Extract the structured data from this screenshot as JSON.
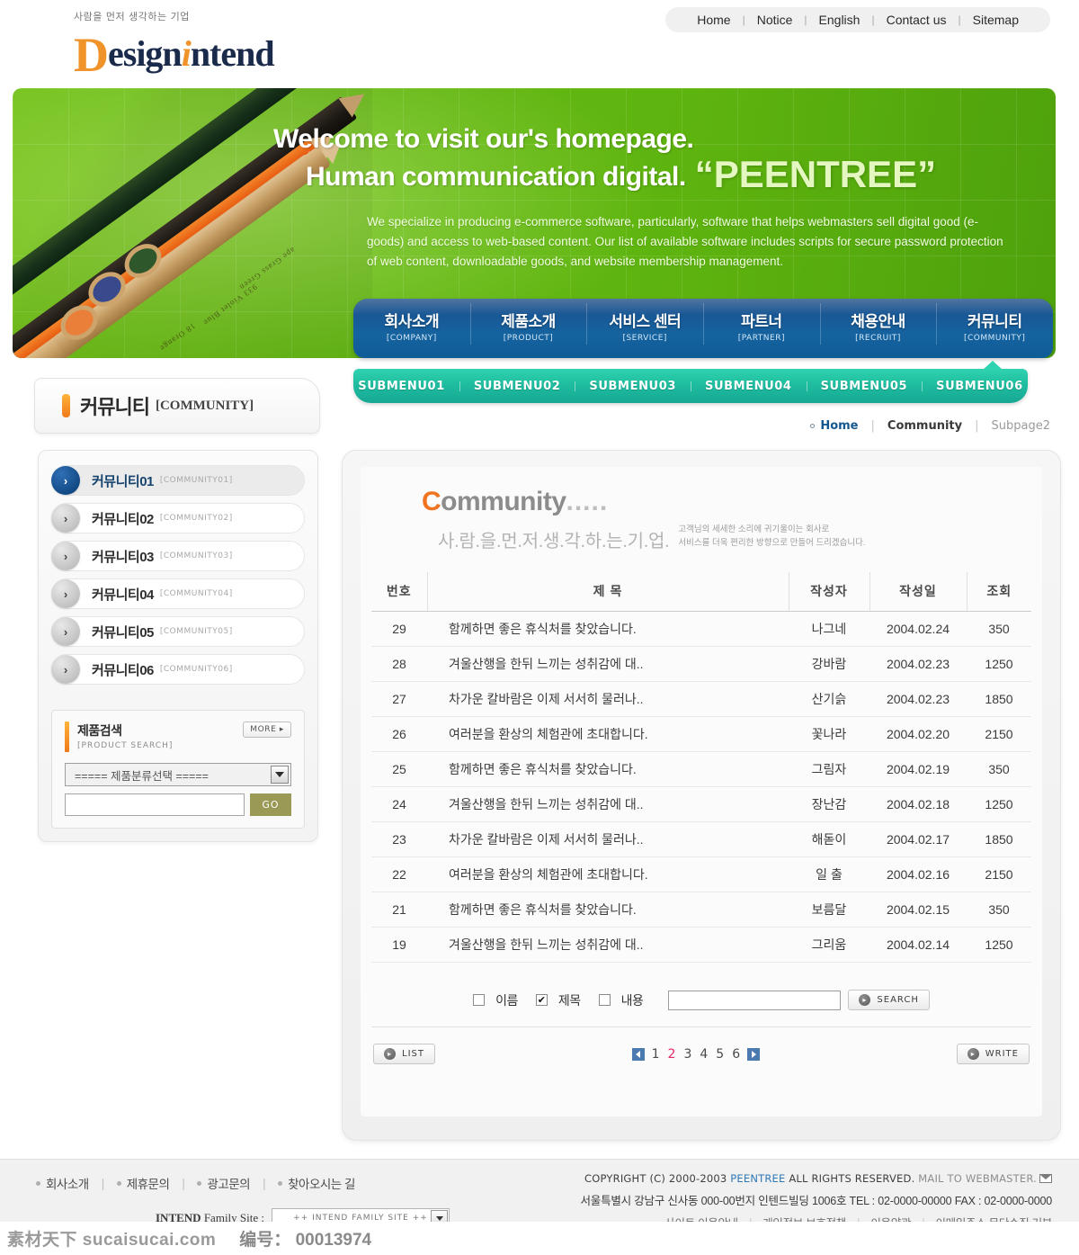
{
  "header": {
    "logo_tagline": "사람을 먼저 생각하는 기업",
    "logo_d": "D",
    "logo_esign": "esign",
    "logo_i": "i",
    "logo_ntend": "ntend",
    "topnav": [
      {
        "label": "Home"
      },
      {
        "label": "Notice"
      },
      {
        "label": "English"
      },
      {
        "label": "Contact us"
      },
      {
        "label": "Sitemap"
      }
    ]
  },
  "banner": {
    "line1": "Welcome to visit our's homepage.",
    "line2": "Human communication digital.",
    "brand": "“PEENTREE”",
    "body": "We specialize in producing e-commerce software, particularly, software that helps webmasters sell digital good (e-goods) and access to web-based content. Our list of available software includes scripts for secure password protection of web content, downloadable goods, and website membership management.",
    "pencil_label_1": "18 Orange",
    "pencil_label_2": "933 Violet Blue",
    "pencil_label_3": "ape Grass Green"
  },
  "mainnav": [
    {
      "ko": "회사소개",
      "en": "[COMPANY]"
    },
    {
      "ko": "제품소개",
      "en": "[PRODUCT]"
    },
    {
      "ko": "서비스 센터",
      "en": "[SERVICE]"
    },
    {
      "ko": "파트너",
      "en": "[PARTNER]"
    },
    {
      "ko": "채용안내",
      "en": "[RECRUIT]"
    },
    {
      "ko": "커뮤니티",
      "en": "[COMMUNITY]"
    }
  ],
  "submenu": [
    {
      "label": "SUBMENU01"
    },
    {
      "label": "SUBMENU02"
    },
    {
      "label": "SUBMENU03"
    },
    {
      "label": "SUBMENU04"
    },
    {
      "label": "SUBMENU05"
    },
    {
      "label": "SUBMENU06"
    }
  ],
  "breadcrumb": {
    "home": "Home",
    "current": "Community",
    "subpage": "Subpage2",
    "separator": "|"
  },
  "sidebar": {
    "title_ko": "커뮤니티",
    "title_en": "[COMMUNITY]",
    "items": [
      {
        "ko": "커뮤니티01",
        "en": "[COMMUNITY01]",
        "arrow": "›"
      },
      {
        "ko": "커뮤니티02",
        "en": "[COMMUNITY02]",
        "arrow": "›"
      },
      {
        "ko": "커뮤니티03",
        "en": "[COMMUNITY03]",
        "arrow": "›"
      },
      {
        "ko": "커뮤니티04",
        "en": "[COMMUNITY04]",
        "arrow": "›"
      },
      {
        "ko": "커뮤니티05",
        "en": "[COMMUNITY05]",
        "arrow": "›"
      },
      {
        "ko": "커뮤니티06",
        "en": "[COMMUNITY06]",
        "arrow": "›"
      }
    ],
    "product_search": {
      "title_ko": "제품검색",
      "title_en": "[PRODUCT SEARCH]",
      "more_label": "MORE ▸",
      "select_value": "===== 제품분류선택 =====",
      "input_value": "",
      "go_label": "GO"
    }
  },
  "content": {
    "heading_c": "C",
    "heading_rest": "ommunity",
    "heading_dots": ".....",
    "sub_ko": "사.람.을.먼.저.생.각.하.는.기.업.",
    "desc_line1": "고객님의 세세한 소리에 귀기울이는 회사로",
    "desc_line2": "서비스를 더욱 편리한 방향으로 만들어 드리겠습니다.",
    "table": {
      "columns": [
        "번호",
        "제  목",
        "작성자",
        "작성일",
        "조회"
      ],
      "rows": [
        {
          "no": "29",
          "title": "함께하면 좋은 휴식처를 찾았습니다.",
          "writer": "나그네",
          "date": "2004.02.24",
          "hits": "350"
        },
        {
          "no": "28",
          "title": "겨울산행을 한뒤 느끼는 성취감에 대..",
          "writer": "강바람",
          "date": "2004.02.23",
          "hits": "1250"
        },
        {
          "no": "27",
          "title": "차가운 칼바람은 이제 서서히 물러나..",
          "writer": "산기슭",
          "date": "2004.02.23",
          "hits": "1850"
        },
        {
          "no": "26",
          "title": "여러분을 환상의 체험관에 초대합니다.",
          "writer": "꽃나라",
          "date": "2004.02.20",
          "hits": "2150"
        },
        {
          "no": "25",
          "title": "함께하면 좋은 휴식처를 찾았습니다.",
          "writer": "그림자",
          "date": "2004.02.19",
          "hits": "350"
        },
        {
          "no": "24",
          "title": "겨울산행을 한뒤 느끼는 성취감에 대..",
          "writer": "장난감",
          "date": "2004.02.18",
          "hits": "1250"
        },
        {
          "no": "23",
          "title": "차가운 칼바람은 이제 서서히 물러나..",
          "writer": "해돋이",
          "date": "2004.02.17",
          "hits": "1850"
        },
        {
          "no": "22",
          "title": "여러분을 환상의 체험관에 초대합니다.",
          "writer": "일  출",
          "date": "2004.02.16",
          "hits": "2150"
        },
        {
          "no": "21",
          "title": "함께하면 좋은 휴식처를 찾았습니다.",
          "writer": "보름달",
          "date": "2004.02.15",
          "hits": "350"
        },
        {
          "no": "19",
          "title": "겨울산행을 한뒤 느끼는 성취감에 대..",
          "writer": "그리움",
          "date": "2004.02.14",
          "hits": "1250"
        }
      ]
    },
    "search": {
      "name_label": "이름",
      "name_checked": false,
      "title_label": "제목",
      "title_checked": true,
      "content_label": "내용",
      "content_checked": false,
      "input_value": "",
      "button_label": "SEARCH",
      "check_mark": "✔"
    },
    "list_button": "LIST",
    "write_button": "WRITE",
    "pagination": {
      "pages": [
        "1",
        "2",
        "3",
        "4",
        "5",
        "6"
      ],
      "current": "2"
    }
  },
  "footer": {
    "links": [
      {
        "label": "회사소개"
      },
      {
        "label": "제휴문의"
      },
      {
        "label": "광고문의"
      },
      {
        "label": "찾아오시는 길"
      }
    ],
    "family_label_bold": "INTEND",
    "family_label_rest": " Family Site :",
    "family_value": "++ INTEND FAMILY SITE ++",
    "copyright_pre": "COPYRIGHT (C) 2000-2003 ",
    "copyright_brand": "PEENTREE",
    "copyright_mid": " ALL RIGHTS RESERVED. ",
    "copyright_mail": "MAIL TO WEBMASTER.",
    "address": "서울특별시  강남구 신사동 000-00번지 인텐드빌딩 1006호  TEL : 02-0000-00000  FAX : 02-0000-0000",
    "policy": [
      {
        "label": "사이트 이용안내"
      },
      {
        "label": "개인정보 보호정책"
      },
      {
        "label": "이용약관"
      },
      {
        "label": "이메일주소 무단수집 거부"
      }
    ]
  },
  "watermark": {
    "site": "素材天下 sucaisucai.com",
    "number": "编号： 00013974"
  }
}
